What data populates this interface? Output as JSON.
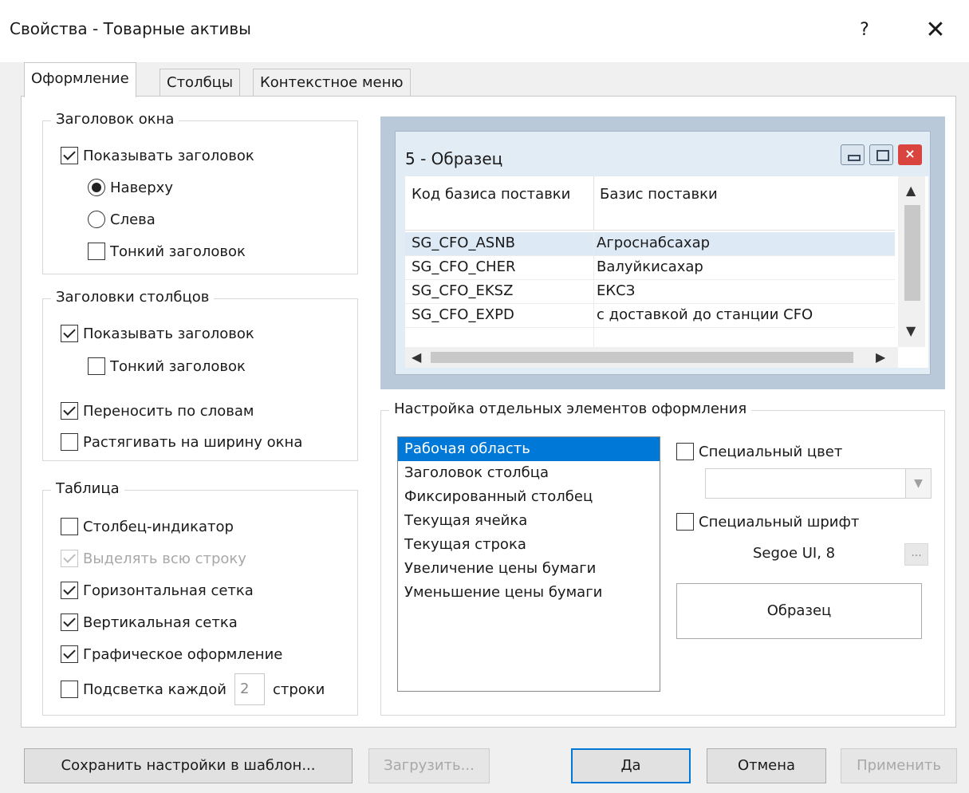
{
  "window": {
    "title": "Свойства - Товарные активы",
    "help_label": "?",
    "close_label": "✕"
  },
  "tabs": [
    {
      "label": "Оформление",
      "active": true
    },
    {
      "label": "Столбцы",
      "active": false
    },
    {
      "label": "Контекстное меню",
      "active": false
    }
  ],
  "window_header": {
    "group_title": "Заголовок окна",
    "show_header": {
      "label": "Показывать заголовок",
      "checked": true
    },
    "top": {
      "label": "Наверху",
      "selected": true
    },
    "left": {
      "label": "Слева",
      "selected": false
    },
    "thin_header": {
      "label": "Тонкий заголовок",
      "checked": false
    }
  },
  "column_headers": {
    "group_title": "Заголовки столбцов",
    "show_header": {
      "label": "Показывать заголовок",
      "checked": true
    },
    "thin_header": {
      "label": "Тонкий заголовок",
      "checked": false
    },
    "word_wrap": {
      "label": "Переносить по словам",
      "checked": true
    },
    "stretch": {
      "label": "Растягивать на ширину окна",
      "checked": false
    }
  },
  "table": {
    "group_title": "Таблица",
    "indicator_column": {
      "label": "Столбец-индикатор",
      "checked": false
    },
    "select_row": {
      "label": "Выделять всю строку",
      "checked": true,
      "disabled": true
    },
    "horizontal_grid": {
      "label": "Горизонтальная сетка",
      "checked": true
    },
    "vertical_grid": {
      "label": "Вертикальная сетка",
      "checked": true
    },
    "graphic_design": {
      "label": "Графическое оформление",
      "checked": true
    },
    "highlight_every_prefix": {
      "label": "Подсветка каждой",
      "checked": false
    },
    "highlight_every_value": "2",
    "highlight_every_suffix": "строки"
  },
  "preview": {
    "title": "5 - Образец",
    "columns": [
      "Код базиса поставки",
      "Базис поставки"
    ],
    "rows": [
      {
        "code": "SG_CFO_ASNB",
        "name": "Агроснабсахар"
      },
      {
        "code": "SG_CFO_CHER",
        "name": "Валуйкисахар"
      },
      {
        "code": "SG_CFO_EKSZ",
        "name": "ЕКСЗ"
      },
      {
        "code": "SG_CFO_EXPD",
        "name": "с доставкой до станции CFO"
      }
    ]
  },
  "elements": {
    "group_title": "Настройка отдельных элементов оформления",
    "items": [
      "Рабочая область",
      "Заголовок столбца",
      "Фиксированный столбец",
      "Текущая ячейка",
      "Текущая строка",
      "Увеличение цены бумаги",
      "Уменьшение цены бумаги"
    ],
    "selected_index": 0,
    "special_color": {
      "label": "Специальный цвет",
      "checked": false
    },
    "special_font": {
      "label": "Специальный шрифт",
      "checked": false
    },
    "font_value": "Segoe UI, 8",
    "font_button": "...",
    "sample_label": "Образец"
  },
  "buttons": {
    "save_template": "Сохранить настройки в шаблон...",
    "load": "Загрузить...",
    "ok": "Да",
    "cancel": "Отмена",
    "apply": "Применить"
  },
  "colors": {
    "accent": "#0078d7",
    "preview_frame": "#b9c9d9",
    "preview_window": "#e2ecf5",
    "close_red": "#d9453e"
  }
}
